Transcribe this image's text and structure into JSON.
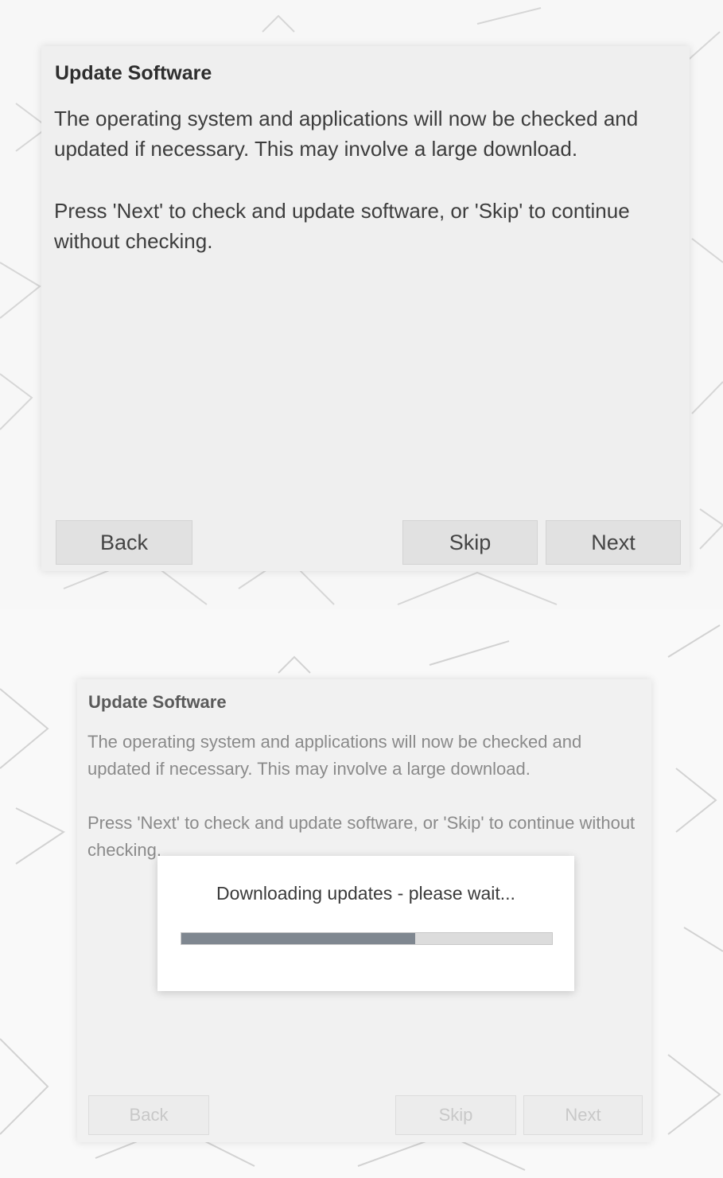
{
  "screens": [
    {
      "dialog": {
        "title": "Update Software",
        "paragraph1": "The operating system and applications will now be checked and updated if necessary. This may involve a large download.",
        "paragraph2": "Press 'Next' to check and update software, or 'Skip' to continue without checking.",
        "buttons": {
          "back": "Back",
          "skip": "Skip",
          "next": "Next"
        }
      }
    },
    {
      "dialog": {
        "title": "Update Software",
        "paragraph1": "The operating system and applications will now be checked and updated if necessary. This may involve a large download.",
        "paragraph2": "Press 'Next' to check and update software, or 'Skip' to continue without checking.",
        "buttons": {
          "back": "Back",
          "skip": "Skip",
          "next": "Next"
        }
      },
      "progress_popup": {
        "message": "Downloading updates - please wait...",
        "progress": 0.63
      }
    }
  ],
  "colors": {
    "dialog_bg": "#efefef",
    "button_bg": "#e1e1e1",
    "progress_fill": "#7f8790",
    "progress_track": "#dcdcdc"
  }
}
